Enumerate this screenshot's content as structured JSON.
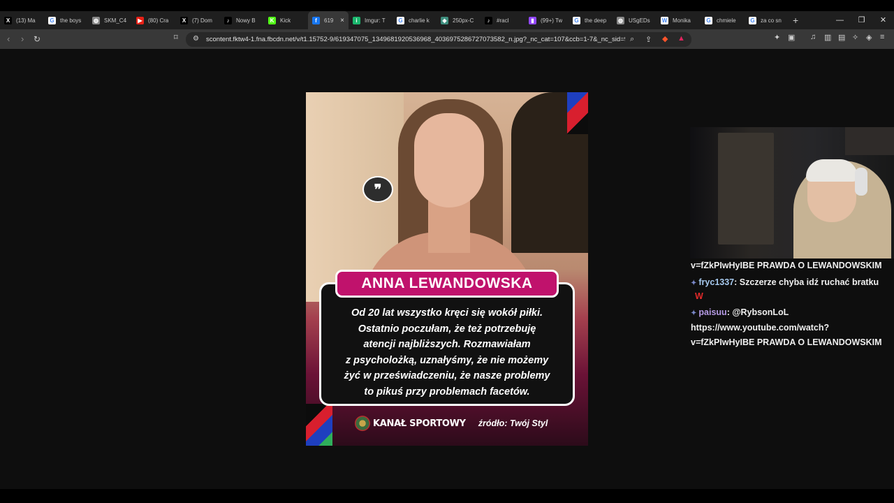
{
  "tabs": [
    {
      "label": "(13) Ma",
      "icon": "x-icon",
      "color": "#000000"
    },
    {
      "label": "the boys",
      "icon": "google-icon",
      "color": "#ffffff"
    },
    {
      "label": "SKM_C4",
      "icon": "globe-icon",
      "color": "#888888"
    },
    {
      "label": "(80) Cra",
      "icon": "youtube-icon",
      "color": "#e62117"
    },
    {
      "label": "(7) Dom",
      "icon": "x-icon",
      "color": "#000000"
    },
    {
      "label": "Nowy B",
      "icon": "tiktok-icon",
      "color": "#000000"
    },
    {
      "label": "Kick",
      "icon": "kick-icon",
      "color": "#53fc18"
    },
    {
      "label": "619",
      "icon": "facebook-icon",
      "color": "#1877f2",
      "active": true
    },
    {
      "label": "Imgur: T",
      "icon": "imgur-icon",
      "color": "#1bb76e"
    },
    {
      "label": "charlie k",
      "icon": "google-icon",
      "color": "#ffffff"
    },
    {
      "label": "250px-C",
      "icon": "image-icon",
      "color": "#3e8e7e"
    },
    {
      "label": "#racl",
      "icon": "tiktok-icon",
      "color": "#000000"
    },
    {
      "label": "(99+) Tw",
      "icon": "twitch-icon",
      "color": "#9146ff"
    },
    {
      "label": "the deep",
      "icon": "google-icon",
      "color": "#ffffff"
    },
    {
      "label": "USgEDs",
      "icon": "globe-icon",
      "color": "#888888"
    },
    {
      "label": "Monika",
      "icon": "wiki-icon",
      "color": "#ffffff"
    },
    {
      "label": "chmiele",
      "icon": "google-icon",
      "color": "#ffffff"
    },
    {
      "label": "za co sn",
      "icon": "google-icon",
      "color": "#ffffff"
    }
  ],
  "url": "scontent.fktw4-1.fna.fbcdn.net/v/t1.15752-9/619347075_1349681920536968_4036975286727073582_n.jpg?_nc_cat=107&ccb=1-7&_nc_sid=9f...",
  "post": {
    "name": "ANNA LEWANDOWSKA",
    "quote_lines": [
      "Od 20 lat wszystko kręci się wokół piłki.",
      "Ostatnio poczułam, że też potrzebuję",
      "atencji najbliższych. Rozmawiałam",
      "z psycholożką, uznałyśmy, że nie możemy",
      "żyć w przeświadczeniu, że nasze problemy",
      "to pikuś przy problemach facetów."
    ],
    "logo_text": "KANAŁ SPORTOWY",
    "source": "źródło: Twój Styl"
  },
  "chat": {
    "line1": "v=fZkPIwHyIBE PRAWDA O LEWANDOWSKIM",
    "msg1_user": "fryc1337",
    "msg1_text": ": Szczerze chyba idź ruchać bratku",
    "msg1_extra": "W",
    "msg2_user": "paisuu",
    "msg2_text": ": @RybsonLoL",
    "msg2_line2": "https://www.youtube.com/watch?",
    "msg2_line3": "v=fZkPIwHyIBE PRAWDA O LEWANDOWSKIM"
  }
}
